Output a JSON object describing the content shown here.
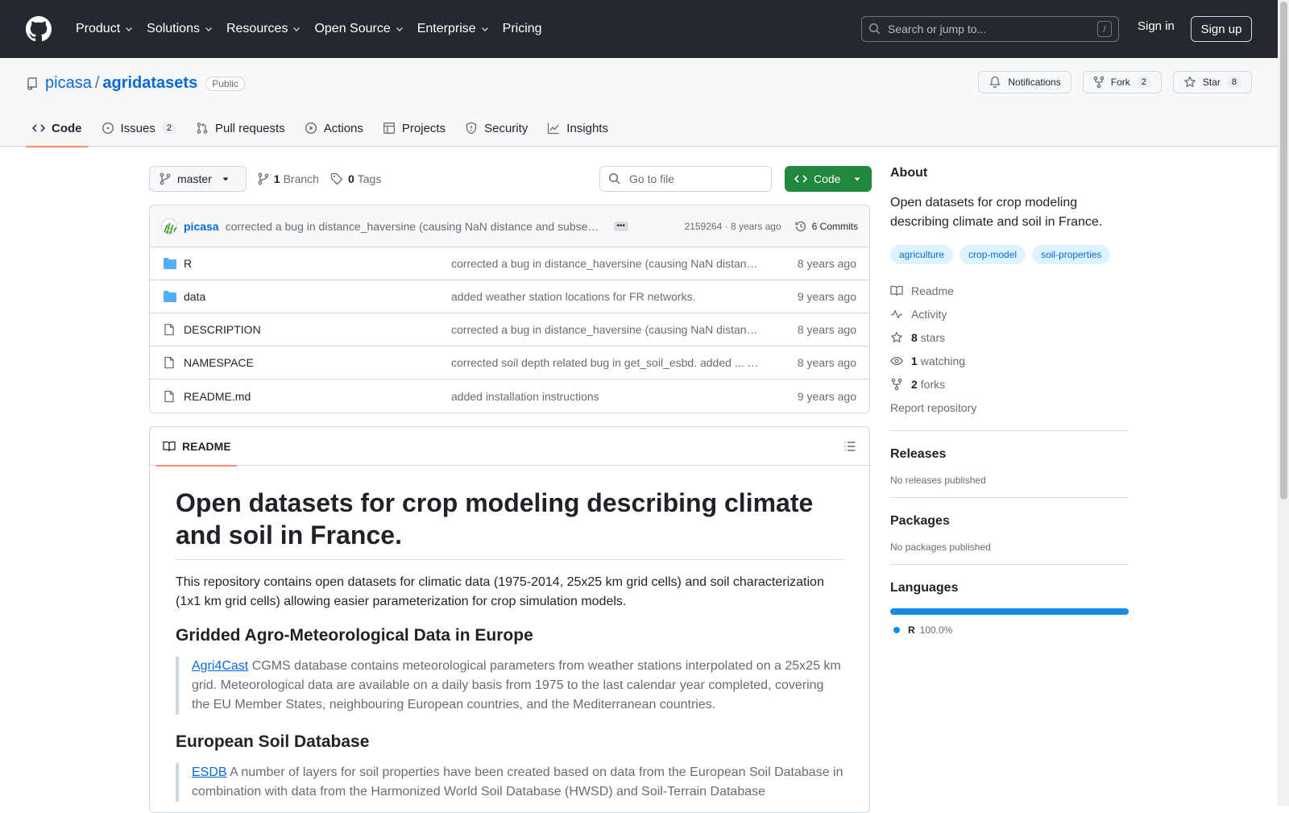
{
  "header": {
    "nav": [
      {
        "label": "Product",
        "dropdown": true
      },
      {
        "label": "Solutions",
        "dropdown": true
      },
      {
        "label": "Resources",
        "dropdown": true
      },
      {
        "label": "Open Source",
        "dropdown": true
      },
      {
        "label": "Enterprise",
        "dropdown": true
      },
      {
        "label": "Pricing",
        "dropdown": false
      }
    ],
    "search_placeholder": "Search or jump to...",
    "search_key": "/",
    "sign_in": "Sign in",
    "sign_up": "Sign up"
  },
  "repo": {
    "owner": "picasa",
    "separator": "/",
    "name": "agridatasets",
    "visibility": "Public",
    "notifications_label": "Notifications",
    "fork_label": "Fork",
    "fork_count": "2",
    "star_label": "Star",
    "star_count": "8",
    "tabs": [
      {
        "label": "Code",
        "active": true,
        "count": "",
        "icon": "code-icon"
      },
      {
        "label": "Issues",
        "active": false,
        "count": "2",
        "icon": "issue-icon"
      },
      {
        "label": "Pull requests",
        "active": false,
        "count": "",
        "icon": "pull-request-icon"
      },
      {
        "label": "Actions",
        "active": false,
        "count": "",
        "icon": "play-icon"
      },
      {
        "label": "Projects",
        "active": false,
        "count": "",
        "icon": "table-icon"
      },
      {
        "label": "Security",
        "active": false,
        "count": "",
        "icon": "shield-icon"
      },
      {
        "label": "Insights",
        "active": false,
        "count": "",
        "icon": "graph-icon"
      }
    ]
  },
  "toolbar": {
    "branch": "master",
    "branch_count": "1",
    "branch_label": "Branch",
    "tag_count": "0",
    "tag_label": "Tags",
    "go_to_file": "Go to file",
    "code_button": "Code"
  },
  "latest_commit": {
    "author": "picasa",
    "message": "corrected a bug in distance_haversine (causing NaN distance and subsequent errors)",
    "hash_age": "2159264 · 8 years ago",
    "commits_label": "6 Commits"
  },
  "files": [
    {
      "type": "folder",
      "name": "R",
      "message": "corrected a bug in distance_haversine (causing NaN distance and subsequent errors)",
      "age": "8 years ago"
    },
    {
      "type": "folder",
      "name": "data",
      "message": "added weather station locations for FR networks.",
      "age": "9 years ago"
    },
    {
      "type": "file",
      "name": "DESCRIPTION",
      "message": "corrected a bug in distance_haversine (causing NaN distance and subsequent errors)",
      "age": "8 years ago"
    },
    {
      "type": "file",
      "name": "NAMESPACE",
      "message": "corrected soil depth related bug in get_soil_esbd. added ... …",
      "age": "8 years ago"
    },
    {
      "type": "file",
      "name": "README.md",
      "message": "added installation instructions",
      "age": "9 years ago"
    }
  ],
  "readme": {
    "tab_label": "README",
    "h1": "Open datasets for crop modeling describing climate and soil in France.",
    "intro": "This repository contains open datasets for climatic data (1975-2014, 25x25 km grid cells) and soil characterization (1x1 km grid cells) allowing easier parameterization for crop simulation models.",
    "section1_title": "Gridded Agro-Meteorological Data in Europe",
    "section1_link": "Agri4Cast",
    "section1_text": " CGMS database contains meteorological parameters from weather stations interpolated on a 25x25 km grid. Meteorological data are available on a daily basis from 1975 to the last calendar year completed, covering the EU Member States, neighbouring European countries, and the Mediterranean countries.",
    "section2_title": "European Soil Database",
    "section2_link": "ESDB",
    "section2_text": " A number of layers for soil properties have been created based on data from the European Soil Database in combination with data from the Harmonized World Soil Database (HWSD) and Soil-Terrain Database"
  },
  "about": {
    "title": "About",
    "description": "Open datasets for crop modeling describing climate and soil in France.",
    "topics": [
      "agriculture",
      "crop-model",
      "soil-properties"
    ],
    "readme_link": "Readme",
    "activity_link": "Activity",
    "stars_count": "8",
    "stars_label": "stars",
    "watching_count": "1",
    "watching_label": "watching",
    "forks_count": "2",
    "forks_label": "forks",
    "report": "Report repository"
  },
  "releases": {
    "title": "Releases",
    "text": "No releases published"
  },
  "packages": {
    "title": "Packages",
    "text": "No packages published"
  },
  "languages": {
    "title": "Languages",
    "items": [
      {
        "name": "R",
        "percent": "100.0%",
        "fraction": 1.0,
        "color": "#198ae2"
      }
    ]
  },
  "colors": {
    "header_bg": "#24292f",
    "accent": "#0969da",
    "code_button": "#1f883d",
    "tab_underline": "#fd8c73"
  }
}
